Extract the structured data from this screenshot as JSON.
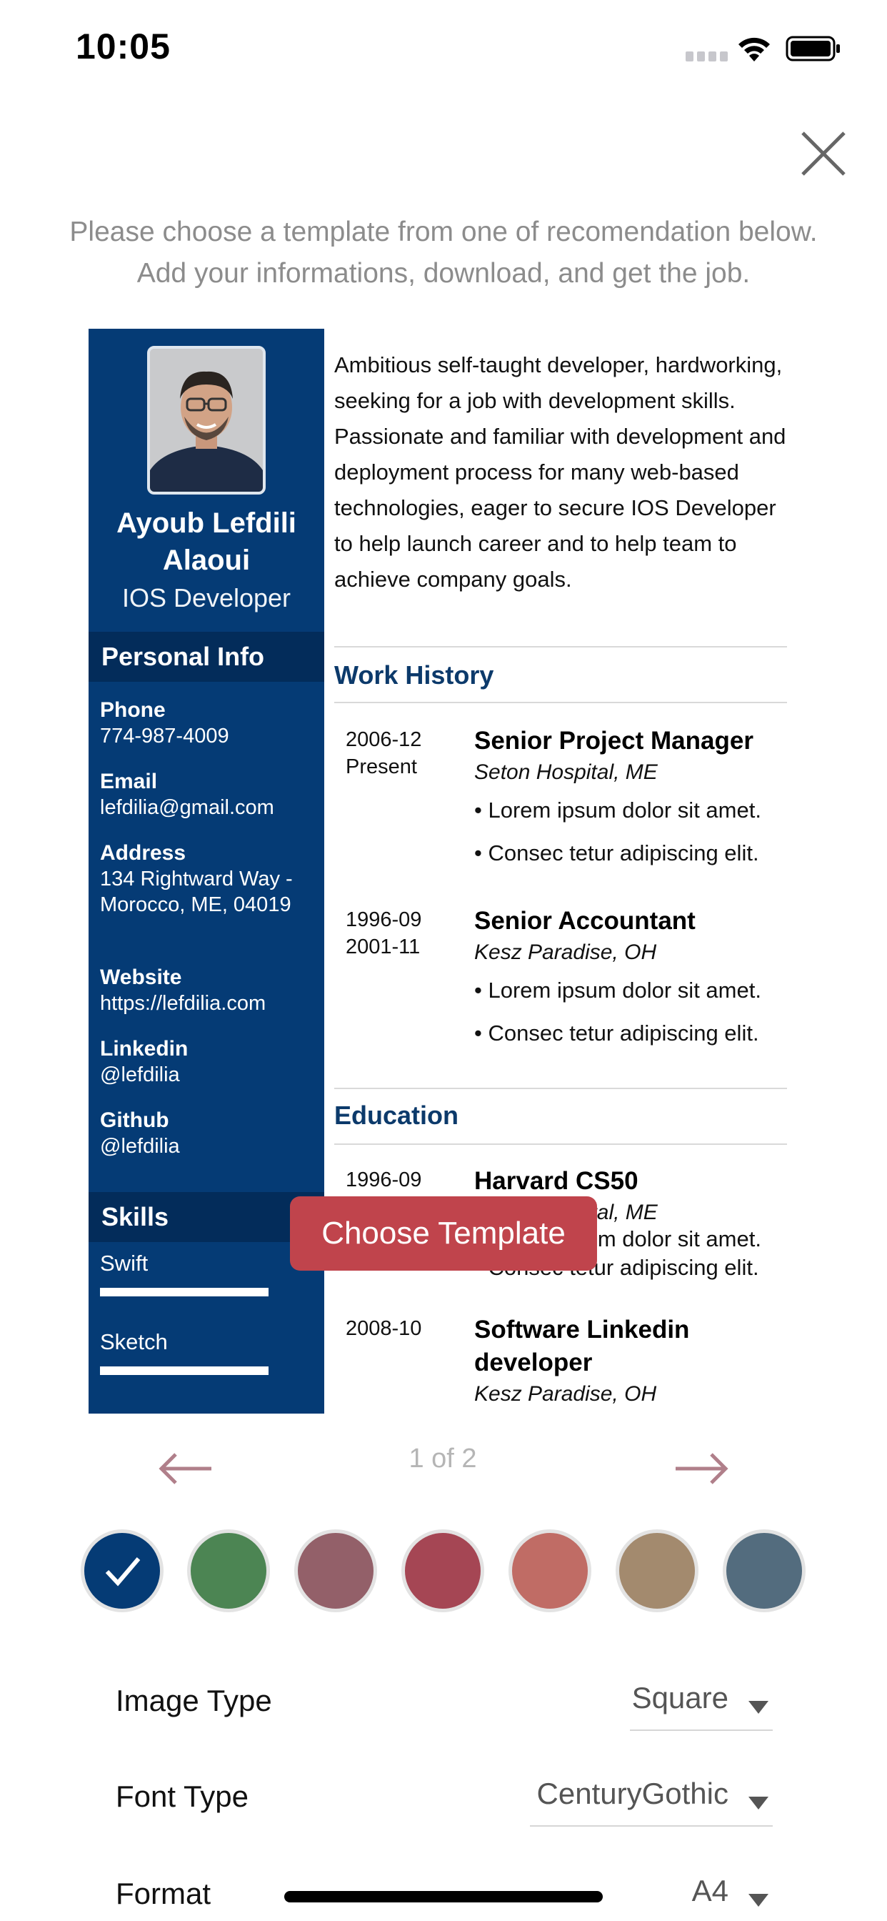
{
  "status_bar": {
    "time": "10:05"
  },
  "intro": {
    "line1": "Please choose a template from one of recomendation below.",
    "line2": "Add your informations, download, and get the job."
  },
  "resume": {
    "name_line1": "Ayoub Lefdili",
    "name_line2": "Alaoui",
    "role": "IOS Developer",
    "personal_info_heading": "Personal Info",
    "personal_info": [
      {
        "label": "Phone",
        "value": "774-987-4009"
      },
      {
        "label": "Email",
        "value": "lefdilia@gmail.com"
      },
      {
        "label": "Address",
        "value": "134 Rightward Way - Morocco, ME, 04019"
      },
      {
        "label": "Website",
        "value": "https://lefdilia.com"
      },
      {
        "label": "Linkedin",
        "value": "@lefdilia"
      },
      {
        "label": "Github",
        "value": "@lefdilia"
      }
    ],
    "skills_heading": "Skills",
    "skills": [
      {
        "name": "Swift",
        "level": 1.0
      },
      {
        "name": "Sketch",
        "level": 1.0
      }
    ],
    "summary": "Ambitious self-taught developer, hardworking, seeking for a job with development skills. Passionate and familiar with development and deployment process for many web-based technologies, eager to secure IOS Developer to help launch career and to help team to achieve company goals.",
    "work_heading": "Work History",
    "work": [
      {
        "date1": "2006-12",
        "date2": "Present",
        "title": "Senior Project Manager",
        "company": "Seton Hospital, ME",
        "bullets": [
          "Lorem ipsum dolor sit amet.",
          "Consec tetur adipiscing elit."
        ]
      },
      {
        "date1": "1996-09",
        "date2": "2001-11",
        "title": "Senior Accountant",
        "company": "Kesz Paradise, OH",
        "bullets": [
          "Lorem ipsum dolor sit amet.",
          "Consec tetur adipiscing elit."
        ]
      }
    ],
    "education_heading": "Education",
    "education": [
      {
        "date1": "1996-09",
        "title": "Harvard CS50",
        "company": "Seton Hospital, ME",
        "bullets": [
          "Lorem ipsum dolor sit amet.",
          "Consec tetur adipiscing elit."
        ]
      },
      {
        "date1": "2008-10",
        "title": "Software Linkedin developer",
        "title_line1": "Software Linkedin",
        "title_line2": "developer",
        "company": "Kesz Paradise, OH"
      }
    ]
  },
  "choose_button": "Choose Template",
  "pager": {
    "text": "1 of 2",
    "arrow_color": "#b07f8a"
  },
  "colors": [
    {
      "hex": "#053b75",
      "selected": true
    },
    {
      "hex": "#4c8553",
      "selected": false
    },
    {
      "hex": "#936069",
      "selected": false
    },
    {
      "hex": "#a54654",
      "selected": false
    },
    {
      "hex": "#c06c65",
      "selected": false
    },
    {
      "hex": "#a38a6e",
      "selected": false
    },
    {
      "hex": "#536c7e",
      "selected": false
    }
  ],
  "options": {
    "image_type": {
      "label": "Image Type",
      "value": "Square"
    },
    "font_type": {
      "label": "Font Type",
      "value": "CenturyGothic"
    },
    "format": {
      "label": "Format",
      "value": "A4"
    }
  },
  "icons": {
    "close": "close-icon",
    "check": "checkmark-icon",
    "prev": "arrow-left-icon",
    "next": "arrow-right-icon",
    "dropdown": "triangle-down-icon"
  }
}
